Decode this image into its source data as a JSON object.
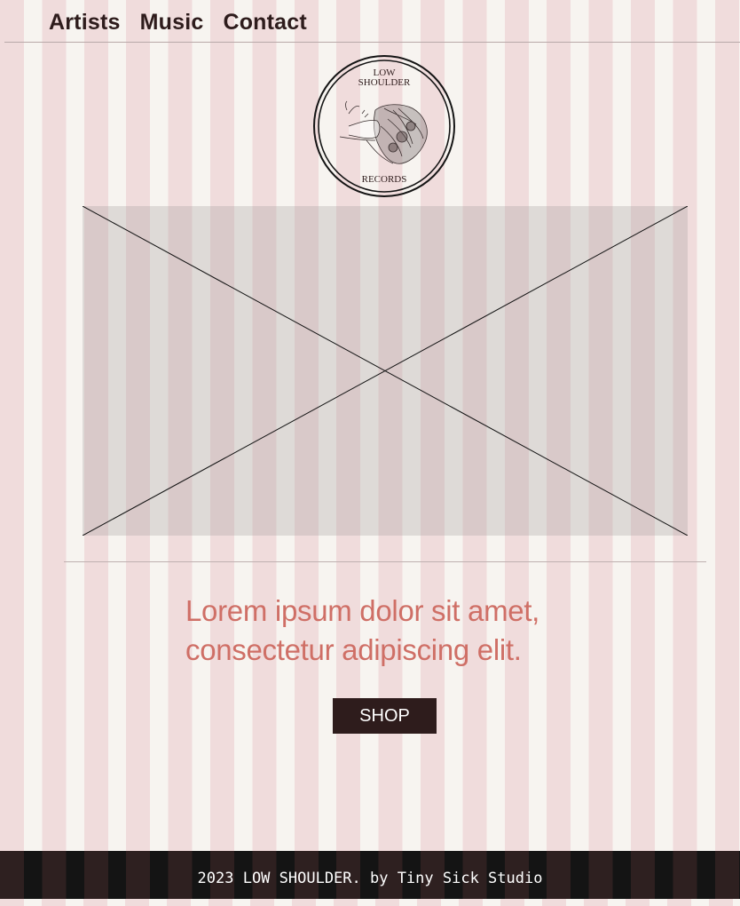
{
  "nav": {
    "items": [
      {
        "label": "Artists"
      },
      {
        "label": "Music"
      },
      {
        "label": "Contact"
      }
    ]
  },
  "logo": {
    "line1": "LOW",
    "line2": "SHOULDER",
    "line3": "RECORDS"
  },
  "hero": {
    "image": "image-placeholder"
  },
  "main": {
    "tagline_line1": "Lorem ipsum dolor sit amet,",
    "tagline_line2": "consectetur adipiscing elit.",
    "shop_label": "SHOP"
  },
  "footer": {
    "text": "2023 LOW SHOULDER. by Tiny Sick Studio"
  },
  "colors": {
    "stripe_pink": "#f0dcdc",
    "stripe_cream": "#f7f4f0",
    "text_dark": "#2e1c1c",
    "accent": "#cf6f66"
  }
}
